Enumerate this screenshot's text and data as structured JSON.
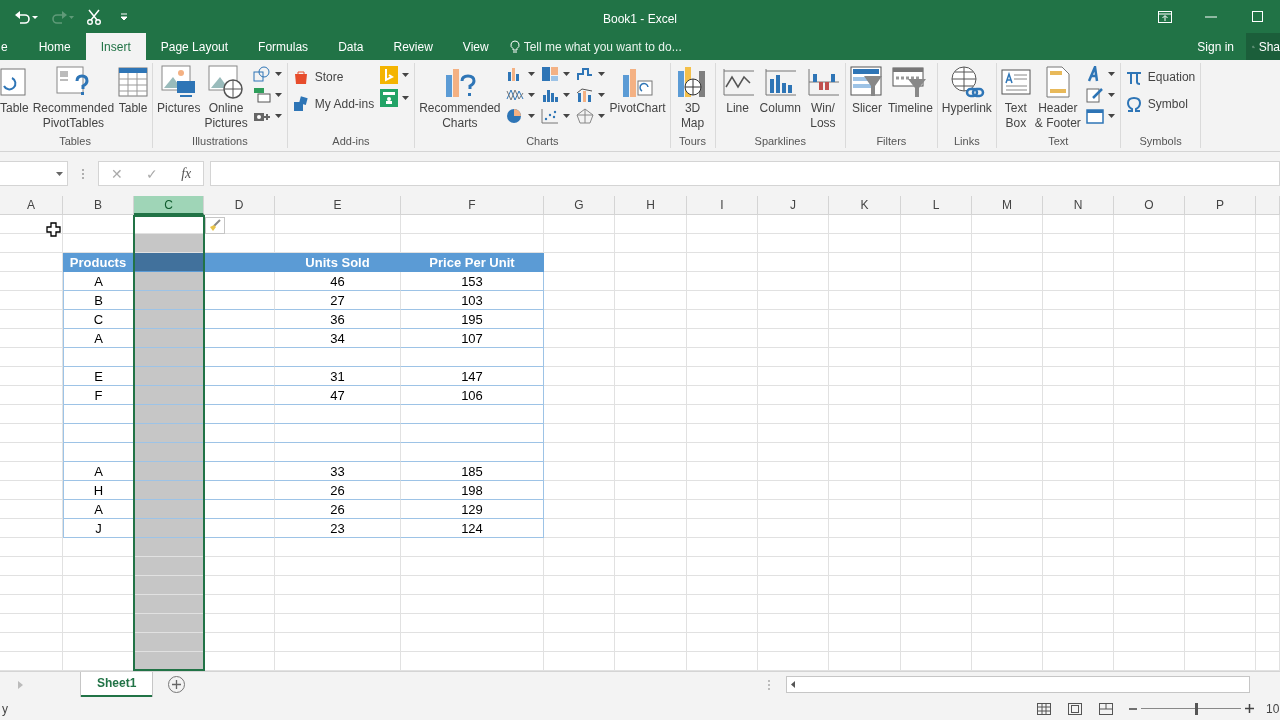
{
  "window": {
    "title": "Book1 - Excel"
  },
  "tabs": [
    {
      "label": "e",
      "selected": false
    },
    {
      "label": "Home",
      "selected": false
    },
    {
      "label": "Insert",
      "selected": true
    },
    {
      "label": "Page Layout",
      "selected": false
    },
    {
      "label": "Formulas",
      "selected": false
    },
    {
      "label": "Data",
      "selected": false
    },
    {
      "label": "Review",
      "selected": false
    },
    {
      "label": "View",
      "selected": false
    }
  ],
  "tell_me": {
    "placeholder": "Tell me what you want to do..."
  },
  "account": {
    "sign_in": "Sign in",
    "share": "Sha"
  },
  "ribbon": [
    {
      "label": "Tables",
      "items": [
        {
          "kind": "large",
          "lines": [
            "Table"
          ]
        },
        {
          "kind": "large",
          "lines": [
            "Recommended",
            "PivotTables"
          ]
        },
        {
          "kind": "large",
          "lines": [
            "Table"
          ]
        }
      ]
    },
    {
      "label": "Illustrations",
      "items": [
        {
          "kind": "large",
          "lines": [
            "Pictures"
          ]
        },
        {
          "kind": "large",
          "lines": [
            "Online",
            "Pictures"
          ]
        },
        {
          "kind": "stack",
          "items": [
            {
              "kind": "icon"
            },
            {
              "kind": "icon"
            },
            {
              "kind": "icon"
            }
          ]
        }
      ]
    },
    {
      "label": "Add-ins",
      "items": [
        {
          "kind": "stack",
          "items": [
            {
              "kind": "small",
              "label": "Store"
            },
            {
              "kind": "small",
              "label": "My Add-ins"
            }
          ]
        },
        {
          "kind": "stack",
          "items": [
            {
              "kind": "icon"
            },
            {
              "kind": "icon"
            }
          ]
        }
      ]
    },
    {
      "label": "Charts",
      "items": [
        {
          "kind": "large",
          "lines": [
            "Recommended",
            "Charts"
          ]
        },
        {
          "kind": "stack",
          "items": [
            {
              "kind": "icon"
            },
            {
              "kind": "icon"
            },
            {
              "kind": "icon"
            }
          ]
        },
        {
          "kind": "stack",
          "items": [
            {
              "kind": "icon"
            },
            {
              "kind": "icon"
            },
            {
              "kind": "icon"
            }
          ]
        },
        {
          "kind": "stack",
          "items": [
            {
              "kind": "icon"
            },
            {
              "kind": "icon"
            },
            {
              "kind": "icon"
            }
          ]
        },
        {
          "kind": "large",
          "lines": [
            "PivotChart"
          ]
        }
      ]
    },
    {
      "label": "Tours",
      "items": [
        {
          "kind": "large",
          "lines": [
            "3D",
            "Map"
          ]
        }
      ]
    },
    {
      "label": "Sparklines",
      "items": [
        {
          "kind": "large",
          "lines": [
            "Line"
          ]
        },
        {
          "kind": "large",
          "lines": [
            "Column"
          ]
        },
        {
          "kind": "large",
          "lines": [
            "Win/",
            "Loss"
          ]
        }
      ]
    },
    {
      "label": "Filters",
      "items": [
        {
          "kind": "large",
          "lines": [
            "Slicer"
          ]
        },
        {
          "kind": "large",
          "lines": [
            "Timeline"
          ]
        }
      ]
    },
    {
      "label": "Links",
      "items": [
        {
          "kind": "large",
          "lines": [
            "Hyperlink"
          ]
        }
      ]
    },
    {
      "label": "Text",
      "items": [
        {
          "kind": "large",
          "lines": [
            "Text",
            "Box"
          ]
        },
        {
          "kind": "large",
          "lines": [
            "Header",
            "& Footer"
          ]
        },
        {
          "kind": "stack",
          "items": [
            {
              "kind": "icon"
            },
            {
              "kind": "icon"
            },
            {
              "kind": "icon"
            }
          ]
        }
      ]
    },
    {
      "label": "Symbols",
      "items": [
        {
          "kind": "stack",
          "items": [
            {
              "kind": "small",
              "label": "Equation"
            },
            {
              "kind": "small",
              "label": "Symbol"
            }
          ]
        }
      ]
    }
  ],
  "formula_bar": {
    "cancel": "✕",
    "enter": "✓",
    "function": "fx"
  },
  "sheet": {
    "columns": [
      {
        "label": "A",
        "selected": false
      },
      {
        "label": "B",
        "selected": false
      },
      {
        "label": "C",
        "selected": true
      },
      {
        "label": "D",
        "selected": false
      },
      {
        "label": "E",
        "selected": false
      },
      {
        "label": "F",
        "selected": false
      },
      {
        "label": "G",
        "selected": false
      },
      {
        "label": "H",
        "selected": false
      },
      {
        "label": "I",
        "selected": false
      },
      {
        "label": "J",
        "selected": false
      },
      {
        "label": "K",
        "selected": false
      },
      {
        "label": "L",
        "selected": false
      },
      {
        "label": "M",
        "selected": false
      },
      {
        "label": "N",
        "selected": false
      },
      {
        "label": "O",
        "selected": false
      },
      {
        "label": "P",
        "selected": false
      }
    ],
    "rows": [
      {
        "kind": "header",
        "cells": [
          "",
          "Products",
          "",
          "",
          "Units Sold",
          "Price Per Unit"
        ]
      },
      {
        "kind": "data",
        "cells": [
          "",
          "A",
          "",
          "",
          "46",
          "153"
        ]
      },
      {
        "kind": "data",
        "cells": [
          "",
          "B",
          "",
          "",
          "27",
          "103"
        ]
      },
      {
        "kind": "data",
        "cells": [
          "",
          "C",
          "",
          "",
          "36",
          "195"
        ]
      },
      {
        "kind": "data",
        "cells": [
          "",
          "A",
          "",
          "",
          "34",
          "107"
        ]
      },
      {
        "kind": "data",
        "cells": [
          "",
          "",
          "",
          "",
          "",
          ""
        ]
      },
      {
        "kind": "data",
        "cells": [
          "",
          "E",
          "",
          "",
          "31",
          "147"
        ]
      },
      {
        "kind": "data",
        "cells": [
          "",
          "F",
          "",
          "",
          "47",
          "106"
        ]
      },
      {
        "kind": "data",
        "cells": [
          "",
          "",
          "",
          "",
          "",
          ""
        ]
      },
      {
        "kind": "data",
        "cells": [
          "",
          "",
          "",
          "",
          "",
          ""
        ]
      },
      {
        "kind": "data",
        "cells": [
          "",
          "",
          "",
          "",
          "",
          ""
        ]
      },
      {
        "kind": "data",
        "cells": [
          "",
          "A",
          "",
          "",
          "33",
          "185"
        ]
      },
      {
        "kind": "data",
        "cells": [
          "",
          "H",
          "",
          "",
          "26",
          "198"
        ]
      },
      {
        "kind": "data",
        "cells": [
          "",
          "A",
          "",
          "",
          "26",
          "129"
        ]
      },
      {
        "kind": "data",
        "cells": [
          "",
          "J",
          "",
          "",
          "23",
          "124"
        ]
      }
    ]
  },
  "sheet_tabs": [
    {
      "label": "Sheet1",
      "selected": true
    }
  ],
  "status_bar": {
    "status": "y",
    "zoom_slider": {
      "level": 0.55
    },
    "zoom": "10"
  }
}
